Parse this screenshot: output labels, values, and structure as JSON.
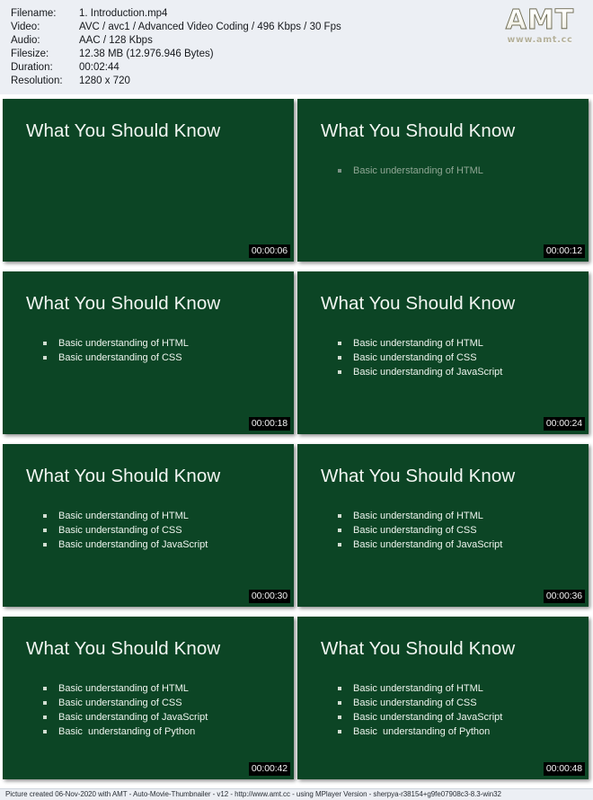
{
  "header": {
    "fields": [
      {
        "label": "Filename:",
        "value": "1. Introduction.mp4"
      },
      {
        "label": "Video:",
        "value": "AVC / avc1 / Advanced Video Coding / 496 Kbps / 30 Fps"
      },
      {
        "label": "Audio:",
        "value": "AAC / 128 Kbps"
      },
      {
        "label": "Filesize:",
        "value": "12.38 MB (12.976.946 Bytes)"
      },
      {
        "label": "Duration:",
        "value": "00:02:44"
      },
      {
        "label": "Resolution:",
        "value": "1280 x 720"
      }
    ],
    "logo": {
      "mark": "AMT",
      "url": "www.amt.cc"
    }
  },
  "thumbnails": [
    {
      "title": "What You Should Know",
      "bullets": [],
      "timestamp": "00:00:06",
      "dim": false
    },
    {
      "title": "What You Should Know",
      "bullets": [
        "Basic understanding of HTML"
      ],
      "timestamp": "00:00:12",
      "dim": true
    },
    {
      "title": "What You Should Know",
      "bullets": [
        "Basic understanding of HTML",
        "Basic understanding of CSS"
      ],
      "timestamp": "00:00:18",
      "dim": false
    },
    {
      "title": "What You Should Know",
      "bullets": [
        "Basic understanding of HTML",
        "Basic understanding of CSS",
        "Basic understanding of JavaScript"
      ],
      "timestamp": "00:00:24",
      "dim": false
    },
    {
      "title": "What You Should Know",
      "bullets": [
        "Basic understanding of HTML",
        "Basic understanding of CSS",
        "Basic understanding of JavaScript"
      ],
      "timestamp": "00:00:30",
      "dim": false
    },
    {
      "title": "What You Should Know",
      "bullets": [
        "Basic understanding of HTML",
        "Basic understanding of CSS",
        "Basic understanding of JavaScript"
      ],
      "timestamp": "00:00:36",
      "dim": false
    },
    {
      "title": "What You Should Know",
      "bullets": [
        "Basic understanding of HTML",
        "Basic understanding of CSS",
        "Basic understanding of JavaScript",
        "Basic  understanding of Python"
      ],
      "timestamp": "00:00:42",
      "dim": false
    },
    {
      "title": "What You Should Know",
      "bullets": [
        "Basic understanding of HTML",
        "Basic understanding of CSS",
        "Basic understanding of JavaScript",
        "Basic  understanding of Python"
      ],
      "timestamp": "00:00:48",
      "dim": false
    }
  ],
  "footer": {
    "text": "Picture created 06-Nov-2020 with AMT - Auto-Movie-Thumbnailer - v12 - http://www.amt.cc - using MPlayer Version - sherpya-r38154+g9fe07908c3-8.3-win32"
  },
  "colors": {
    "slide_background": "#0c4525",
    "panel_background": "#eceff4",
    "timestamp_background": "#000000",
    "title_text": "#f2f6f2"
  }
}
